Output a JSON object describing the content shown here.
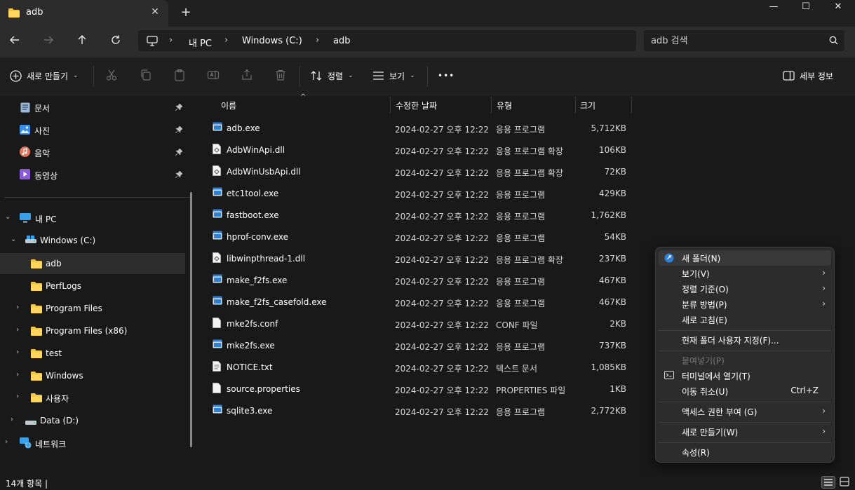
{
  "titlebar": {
    "tab_label": "adb",
    "close_tab": "✕",
    "new_tab": "+",
    "minimize": "—",
    "maximize": "☐",
    "close_window": "✕"
  },
  "address": {
    "crumbs": [
      "내 PC",
      "Windows  (C:)",
      "adb"
    ],
    "separator": "›",
    "search_placeholder": "adb 검색"
  },
  "toolbar": {
    "new_label": "새로 만들기",
    "sort_label": "정렬",
    "view_label": "보기",
    "more_label": "•••",
    "details_label": "세부 정보"
  },
  "sidebar": {
    "quick_access": [
      {
        "label": "문서",
        "icon": "document-icon"
      },
      {
        "label": "사진",
        "icon": "pictures-icon"
      },
      {
        "label": "음악",
        "icon": "music-icon"
      },
      {
        "label": "동영상",
        "icon": "video-icon"
      }
    ],
    "tree": [
      {
        "label": "내 PC",
        "level": 0,
        "expand": "v"
      },
      {
        "label": "Windows  (C:)",
        "level": 1,
        "expand": "v"
      },
      {
        "label": "adb",
        "level": 2,
        "expand": ""
      },
      {
        "label": "PerfLogs",
        "level": 2,
        "expand": ""
      },
      {
        "label": "Program Files",
        "level": 2,
        "expand": ">"
      },
      {
        "label": "Program Files (x86)",
        "level": 2,
        "expand": ">"
      },
      {
        "label": "test",
        "level": 2,
        "expand": ">"
      },
      {
        "label": "Windows",
        "level": 2,
        "expand": ">"
      },
      {
        "label": "사용자",
        "level": 2,
        "expand": ">"
      },
      {
        "label": "Data (D:)",
        "level": 1,
        "expand": ">"
      },
      {
        "label": "네트워크",
        "level": 0,
        "expand": ">"
      }
    ]
  },
  "columns": {
    "name": "이름",
    "date": "수정한 날짜",
    "type": "유형",
    "size": "크기",
    "sort_indicator": "^"
  },
  "files": [
    {
      "name": "adb.exe",
      "date": "2024-02-27 오후 12:22",
      "type": "응용 프로그램",
      "size": "5,712KB",
      "kind": "exe"
    },
    {
      "name": "AdbWinApi.dll",
      "date": "2024-02-27 오후 12:22",
      "type": "응용 프로그램 확장",
      "size": "106KB",
      "kind": "dll"
    },
    {
      "name": "AdbWinUsbApi.dll",
      "date": "2024-02-27 오후 12:22",
      "type": "응용 프로그램 확장",
      "size": "72KB",
      "kind": "dll"
    },
    {
      "name": "etc1tool.exe",
      "date": "2024-02-27 오후 12:22",
      "type": "응용 프로그램",
      "size": "429KB",
      "kind": "exe"
    },
    {
      "name": "fastboot.exe",
      "date": "2024-02-27 오후 12:22",
      "type": "응용 프로그램",
      "size": "1,762KB",
      "kind": "exe"
    },
    {
      "name": "hprof-conv.exe",
      "date": "2024-02-27 오후 12:22",
      "type": "응용 프로그램",
      "size": "54KB",
      "kind": "exe"
    },
    {
      "name": "libwinpthread-1.dll",
      "date": "2024-02-27 오후 12:22",
      "type": "응용 프로그램 확장",
      "size": "237KB",
      "kind": "dll"
    },
    {
      "name": "make_f2fs.exe",
      "date": "2024-02-27 오후 12:22",
      "type": "응용 프로그램",
      "size": "467KB",
      "kind": "exe"
    },
    {
      "name": "make_f2fs_casefold.exe",
      "date": "2024-02-27 오후 12:22",
      "type": "응용 프로그램",
      "size": "467KB",
      "kind": "exe"
    },
    {
      "name": "mke2fs.conf",
      "date": "2024-02-27 오후 12:22",
      "type": "CONF 파일",
      "size": "2KB",
      "kind": "file"
    },
    {
      "name": "mke2fs.exe",
      "date": "2024-02-27 오후 12:22",
      "type": "응용 프로그램",
      "size": "737KB",
      "kind": "exe"
    },
    {
      "name": "NOTICE.txt",
      "date": "2024-02-27 오후 12:22",
      "type": "텍스트 문서",
      "size": "1,085KB",
      "kind": "txt"
    },
    {
      "name": "source.properties",
      "date": "2024-02-27 오후 12:22",
      "type": "PROPERTIES 파일",
      "size": "1KB",
      "kind": "file"
    },
    {
      "name": "sqlite3.exe",
      "date": "2024-02-27 오후 12:22",
      "type": "응용 프로그램",
      "size": "2,772KB",
      "kind": "exe"
    }
  ],
  "context_menu": {
    "items": [
      {
        "label": "새 폴더(N)",
        "arrow": "",
        "shortcut": ""
      },
      {
        "label": "보기(V)",
        "arrow": "›",
        "shortcut": ""
      },
      {
        "label": "정렬 기준(O)",
        "arrow": "›",
        "shortcut": ""
      },
      {
        "label": "분류 방법(P)",
        "arrow": "›",
        "shortcut": ""
      },
      {
        "label": "새로 고침(E)",
        "arrow": "",
        "shortcut": ""
      },
      {
        "label": "현재 폴더 사용자 지정(F)...",
        "arrow": "",
        "shortcut": ""
      },
      {
        "label": "붙여넣기(P)",
        "arrow": "",
        "shortcut": ""
      },
      {
        "label": "터미널에서 열기(T)",
        "arrow": "",
        "shortcut": ""
      },
      {
        "label": "이동 취소(U)",
        "arrow": "",
        "shortcut": "Ctrl+Z"
      },
      {
        "label": "액세스 권한 부여 (G)",
        "arrow": "›",
        "shortcut": ""
      },
      {
        "label": "새로 만들기(W)",
        "arrow": "›",
        "shortcut": ""
      },
      {
        "label": "속성(R)",
        "arrow": "",
        "shortcut": ""
      }
    ]
  },
  "status": {
    "item_count": "14개 항목  |"
  },
  "colors": {
    "folder": "#f4c542",
    "exe_blue": "#2f7fd6",
    "accent": "#4aa3f0"
  }
}
